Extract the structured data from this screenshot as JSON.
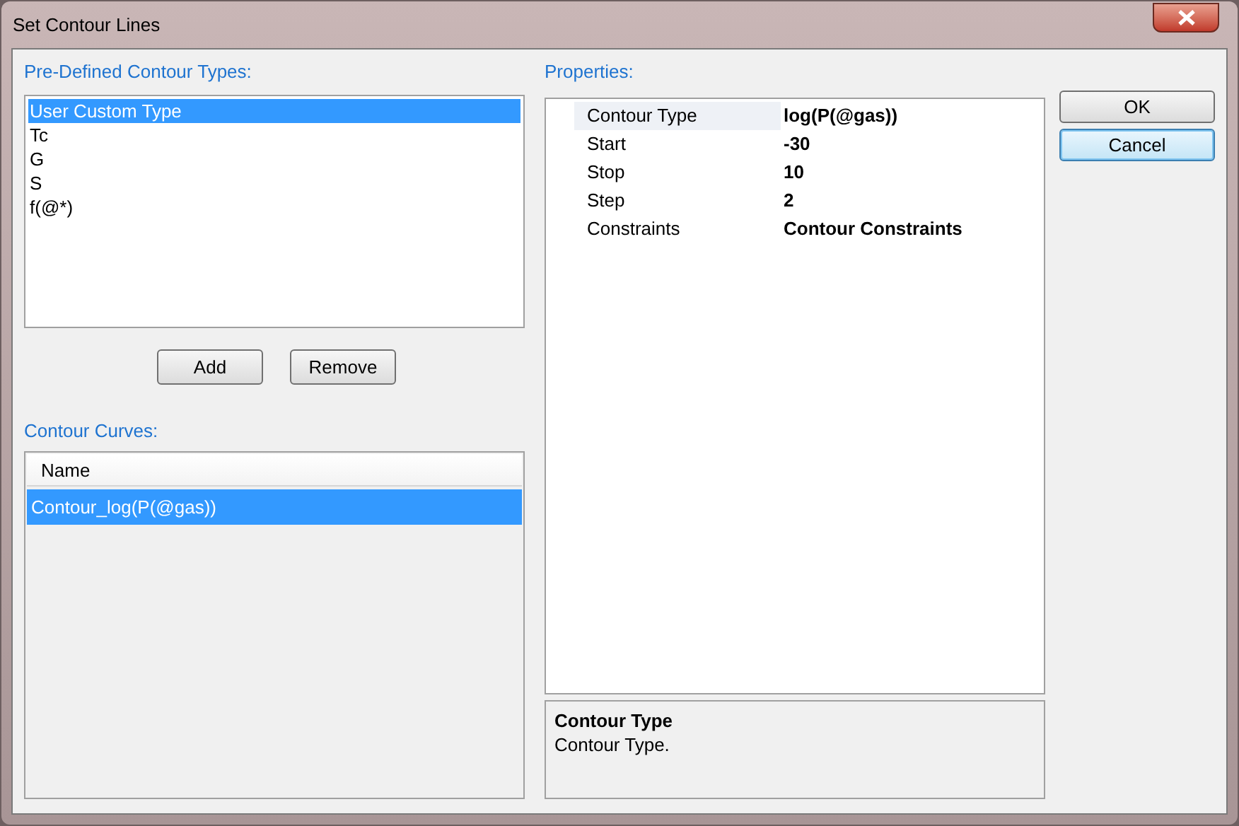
{
  "window": {
    "title": "Set Contour Lines"
  },
  "predefined": {
    "label": "Pre-Defined Contour Types:",
    "items": [
      {
        "label": "User Custom Type",
        "selected": true
      },
      {
        "label": "Tc",
        "selected": false
      },
      {
        "label": "G",
        "selected": false
      },
      {
        "label": "S",
        "selected": false
      },
      {
        "label": "f(@*)",
        "selected": false
      }
    ]
  },
  "list_buttons": [
    "Add",
    "Remove"
  ],
  "curves": {
    "label": "Contour Curves:",
    "columns": [
      "Name"
    ],
    "rows": [
      {
        "name": "Contour_log(P(@gas))",
        "selected": true
      }
    ]
  },
  "properties": {
    "label": "Properties:",
    "rows": [
      {
        "name": "Contour Type",
        "value": "log(P(@gas))",
        "selected": true
      },
      {
        "name": "Start",
        "value": "-30",
        "selected": false
      },
      {
        "name": "Stop",
        "value": "10",
        "selected": false
      },
      {
        "name": "Step",
        "value": "2",
        "selected": false
      },
      {
        "name": "Constraints",
        "value": "Contour Constraints",
        "selected": false
      }
    ]
  },
  "description": {
    "title": "Contour Type",
    "text": "Contour Type."
  },
  "buttons": [
    {
      "label": "OK",
      "focused": false
    },
    {
      "label": "Cancel",
      "focused": true
    }
  ]
}
